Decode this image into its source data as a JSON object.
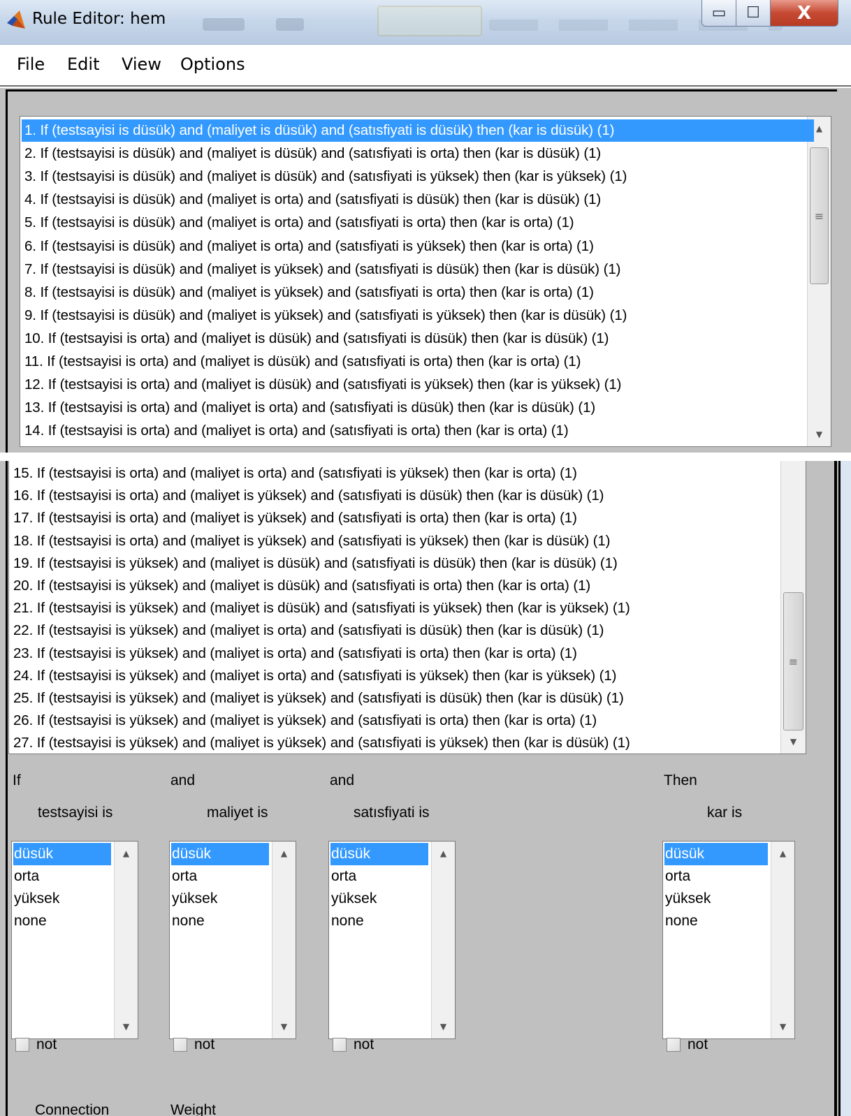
{
  "window": {
    "title": "Rule Editor: hem",
    "controls": {
      "minimize": "▭",
      "maximize": "☐",
      "close": "X"
    }
  },
  "menu": [
    "File",
    "Edit",
    "View",
    "Options"
  ],
  "rules": [
    "1. If (testsayisi is düsük) and (maliyet is düsük) and (satısfiyati is düsük) then (kar is düsük) (1)",
    "2. If (testsayisi is düsük) and (maliyet is düsük) and (satısfiyati is orta) then (kar is düsük) (1)",
    "3. If (testsayisi is düsük) and (maliyet is düsük) and (satısfiyati is yüksek) then (kar is yüksek) (1)",
    "4. If (testsayisi is düsük) and (maliyet is orta) and (satısfiyati is düsük) then (kar is düsük) (1)",
    "5. If (testsayisi is düsük) and (maliyet is orta) and (satısfiyati is orta) then (kar is orta) (1)",
    "6. If (testsayisi is düsük) and (maliyet is orta) and (satısfiyati is yüksek) then (kar is orta) (1)",
    "7. If (testsayisi is düsük) and (maliyet is yüksek) and (satısfiyati is düsük) then (kar is düsük) (1)",
    "8. If (testsayisi is düsük) and (maliyet is yüksek) and (satısfiyati is orta) then (kar is orta) (1)",
    "9. If (testsayisi is düsük) and (maliyet is yüksek) and (satısfiyati is yüksek) then (kar is düsük) (1)",
    "10. If (testsayisi is orta) and (maliyet is düsük) and (satısfiyati is düsük) then (kar is düsük) (1)",
    "11. If (testsayisi is orta) and (maliyet is düsük) and (satısfiyati is orta) then (kar is orta) (1)",
    "12. If (testsayisi is orta) and (maliyet is düsük) and (satısfiyati is yüksek) then (kar is yüksek) (1)",
    "13. If (testsayisi is orta) and (maliyet is orta) and (satısfiyati is düsük) then (kar is düsük) (1)",
    "14. If (testsayisi is orta) and (maliyet is orta) and (satısfiyati is orta) then (kar is orta) (1)",
    "15. If (testsayisi is orta) and (maliyet is orta) and (satısfiyati is yüksek) then (kar is orta) (1)",
    "16. If (testsayisi is orta) and (maliyet is yüksek) and (satısfiyati is düsük) then (kar is düsük) (1)",
    "17. If (testsayisi is orta) and (maliyet is yüksek) and (satısfiyati is orta) then (kar is orta) (1)",
    "18. If (testsayisi is orta) and (maliyet is yüksek) and (satısfiyati is yüksek) then (kar is düsük) (1)",
    "19. If (testsayisi is yüksek) and (maliyet is düsük) and (satısfiyati is düsük) then (kar is düsük) (1)",
    "20. If (testsayisi is yüksek) and (maliyet is düsük) and (satısfiyati is orta) then (kar is orta) (1)",
    "21. If (testsayisi is yüksek) and (maliyet is düsük) and (satısfiyati is yüksek) then (kar is yüksek) (1)",
    "22. If (testsayisi is yüksek) and (maliyet is orta) and (satısfiyati is düsük) then (kar is düsük) (1)",
    "23. If (testsayisi is yüksek) and (maliyet is orta) and (satısfiyati is orta) then (kar is orta) (1)",
    "24. If (testsayisi is yüksek) and (maliyet is orta) and (satısfiyati is yüksek) then (kar is yüksek) (1)",
    "25. If (testsayisi is yüksek) and (maliyet is yüksek) and (satısfiyati is düsük) then (kar is düsük) (1)",
    "26. If (testsayisi is yüksek) and (maliyet is yüksek) and (satısfiyati is orta) then (kar is orta) (1)",
    "27. If (testsayisi is yüksek) and (maliyet is yüksek) and (satısfiyati is yüksek) then (kar is düsük) (1)"
  ],
  "selected_rule": 1,
  "scroll_icons": {
    "up": "▲",
    "down": "▼",
    "grip": "≡"
  },
  "editor": {
    "col1": {
      "connector": "If",
      "variable": "testsayisi is"
    },
    "col2": {
      "connector": "and",
      "variable": "maliyet is"
    },
    "col3": {
      "connector": "and",
      "variable": "satısfiyati is"
    },
    "col4": {
      "connector": "Then",
      "variable": "kar is"
    },
    "mf_options": [
      "düsük",
      "orta",
      "yüksek",
      "none"
    ],
    "selected_mf": "düsük",
    "not_label": "not"
  },
  "footer": {
    "connection_label": "Connection",
    "weight_label": "Weight"
  },
  "colors": {
    "selection": "#3399ff",
    "window_body": "#c0c0c0",
    "close_button": "#c64a33"
  }
}
